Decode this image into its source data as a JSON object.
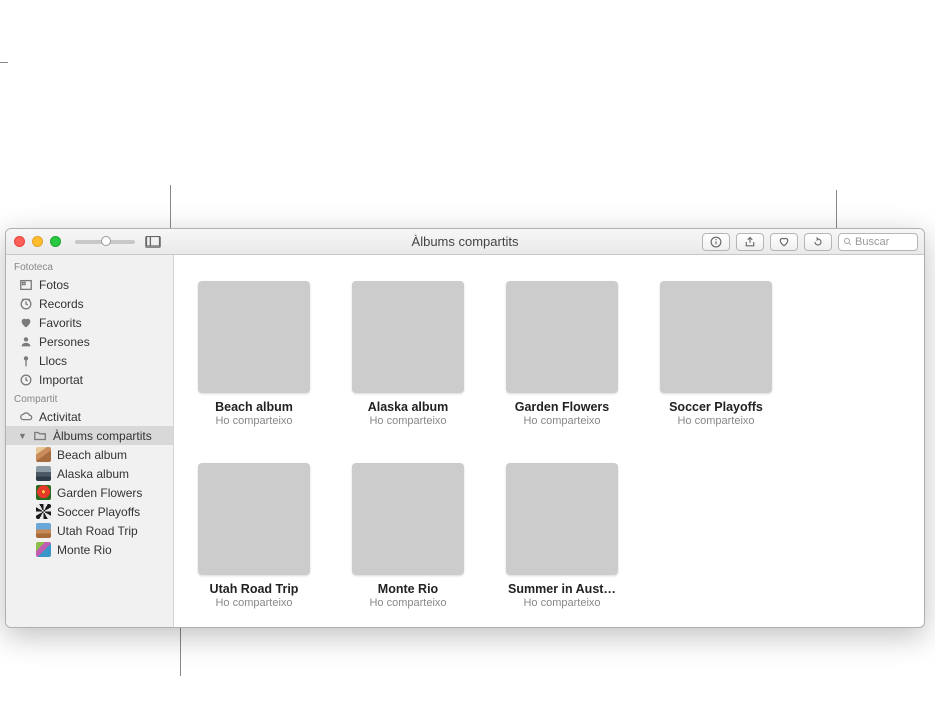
{
  "window": {
    "title": "Àlbums compartits"
  },
  "search": {
    "placeholder": "Buscar"
  },
  "sidebar": {
    "section_library": "Fototeca",
    "section_shared": "Compartit",
    "library": [
      {
        "label": "Fotos",
        "icon": "photos"
      },
      {
        "label": "Records",
        "icon": "memories"
      },
      {
        "label": "Favorits",
        "icon": "heart"
      },
      {
        "label": "Persones",
        "icon": "people"
      },
      {
        "label": "Llocs",
        "icon": "pin"
      },
      {
        "label": "Importat",
        "icon": "clock"
      }
    ],
    "shared": [
      {
        "label": "Activitat",
        "icon": "cloud"
      },
      {
        "label": "Àlbums compartits",
        "icon": "folder",
        "selected": true
      }
    ],
    "shared_albums": [
      {
        "label": "Beach album",
        "thumb": "cov-beach"
      },
      {
        "label": "Alaska album",
        "thumb": "cov-alaska"
      },
      {
        "label": "Garden Flowers",
        "thumb": "cov-flowers"
      },
      {
        "label": "Soccer Playoffs",
        "thumb": "cov-soccer"
      },
      {
        "label": "Utah Road Trip",
        "thumb": "cov-utah"
      },
      {
        "label": "Monte Rio",
        "thumb": "cov-monte"
      }
    ]
  },
  "albums": [
    {
      "name": "Beach album",
      "subtitle": "Ho comparteixo",
      "cover": "cov-beach"
    },
    {
      "name": "Alaska album",
      "subtitle": "Ho comparteixo",
      "cover": "cov-alaska"
    },
    {
      "name": "Garden Flowers",
      "subtitle": "Ho comparteixo",
      "cover": "cov-flowers"
    },
    {
      "name": "Soccer Playoffs",
      "subtitle": "Ho comparteixo",
      "cover": "cov-soccer"
    },
    {
      "name": "Utah Road Trip",
      "subtitle": "Ho comparteixo",
      "cover": "cov-utah"
    },
    {
      "name": "Monte Rio",
      "subtitle": "Ho comparteixo",
      "cover": "cov-monte"
    },
    {
      "name": "Summer in Aust…",
      "subtitle": "Ho comparteixo",
      "cover": "cov-summer"
    }
  ]
}
